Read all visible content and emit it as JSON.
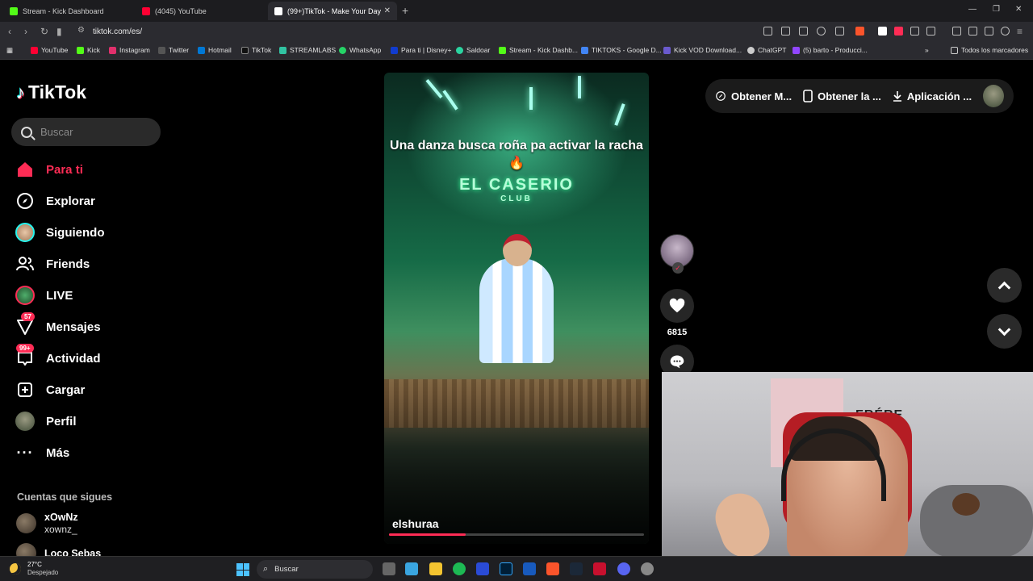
{
  "browser": {
    "tabs": [
      {
        "label": "Stream - Kick Dashboard",
        "color": "#53fc18"
      },
      {
        "label": "(4045) YouTube",
        "color": "#ff0033"
      },
      {
        "label": "(99+)TikTok - Make Your Day",
        "color": "#000000"
      }
    ],
    "url": "tiktok.com/es/",
    "bookmarks": [
      {
        "label": "YouTube",
        "color": "#ff0033"
      },
      {
        "label": "Kick",
        "color": "#53fc18"
      },
      {
        "label": "Instagram",
        "color": "#e1306c"
      },
      {
        "label": "Twitter",
        "color": "#ffffff"
      },
      {
        "label": "Hotmail",
        "color": "#0078d4"
      },
      {
        "label": "TikTok",
        "color": "#000000"
      },
      {
        "label": "STREAMLABS",
        "color": "#31c3a2"
      },
      {
        "label": "WhatsApp",
        "color": "#25d366"
      },
      {
        "label": "Para ti | Disney+",
        "color": "#113ccf"
      },
      {
        "label": "Saldoar",
        "color": "#2bd4a0"
      },
      {
        "label": "Stream - Kick Dashb...",
        "color": "#53fc18"
      },
      {
        "label": "TIKTOKS - Google D...",
        "color": "#4285f4"
      },
      {
        "label": "Kick VOD Download...",
        "color": "#6a5acd"
      },
      {
        "label": "ChatGPT",
        "color": "#cccccc"
      },
      {
        "label": "(5) barto - Producci...",
        "color": "#9146ff"
      }
    ],
    "all_bookmarks": "Todos los marcadores"
  },
  "tiktok": {
    "logo": "TikTok",
    "search_placeholder": "Buscar",
    "nav": [
      {
        "label": "Para ti",
        "icon": "home-icon",
        "active": true
      },
      {
        "label": "Explorar",
        "icon": "compass-icon"
      },
      {
        "label": "Siguiendo",
        "icon": "following-avatar"
      },
      {
        "label": "Friends",
        "icon": "friends-icon"
      },
      {
        "label": "LIVE",
        "icon": "live-avatar"
      },
      {
        "label": "Mensajes",
        "icon": "messages-icon",
        "badge": "57"
      },
      {
        "label": "Actividad",
        "icon": "activity-icon",
        "badge": "99+"
      },
      {
        "label": "Cargar",
        "icon": "upload-icon"
      },
      {
        "label": "Perfil",
        "icon": "profile-avatar"
      },
      {
        "label": "Más",
        "icon": "more-icon"
      }
    ],
    "following_title": "Cuentas que sigues",
    "following": [
      {
        "name": "xOwNz",
        "handle": "xownz_"
      },
      {
        "name": "Loco Sebas",
        "handle": ""
      }
    ],
    "video": {
      "caption": "Una danza busca roña pa activar la racha 🔥",
      "club_sign": "EL CASERIO",
      "club_sign_sub": "CLUB",
      "uploader": "elshuraa",
      "progress": 0.3
    },
    "actions": {
      "likes": "6815"
    },
    "top_right": {
      "btn1": "Obtener M...",
      "btn2": "Obtener la ...",
      "btn3": "Aplicación ..."
    }
  },
  "webcam": {
    "sign_text": "FRÉRE"
  },
  "taskbar": {
    "temp": "27°C",
    "weather": "Despejado",
    "search_placeholder": "Buscar"
  }
}
